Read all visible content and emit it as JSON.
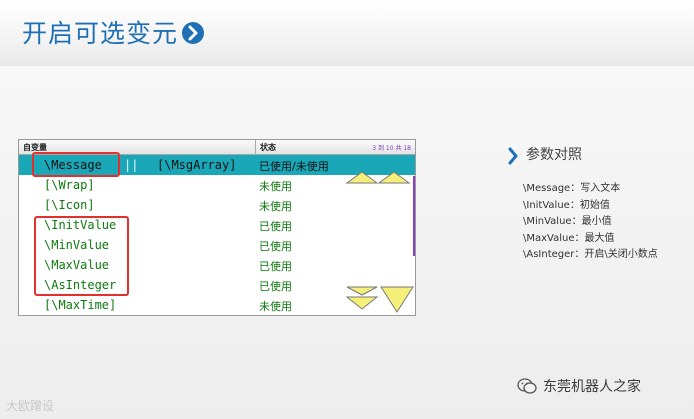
{
  "header": {
    "title": "开启可选变元"
  },
  "panel": {
    "col_arg": "自变量",
    "col_status": "状态",
    "pager": "3 到 10 共 18",
    "rows": [
      {
        "arg": "\\Message",
        "sep": "||",
        "alt": "[\\MsgArray]",
        "status": "已使用/未使用",
        "selected": true
      },
      {
        "arg": "[\\Wrap]",
        "status": "未使用"
      },
      {
        "arg": "[\\Icon]",
        "status": "未使用"
      },
      {
        "arg": "\\InitValue",
        "status": "已使用"
      },
      {
        "arg": "\\MinValue",
        "status": "已使用"
      },
      {
        "arg": "\\MaxValue",
        "status": "已使用"
      },
      {
        "arg": "\\AsInteger",
        "status": "已使用"
      },
      {
        "arg": "[\\MaxTime]",
        "status": "未使用"
      }
    ]
  },
  "reference": {
    "title": "参数对照",
    "items": [
      "\\Message：写入文本",
      "\\InitValue：初始值",
      "\\MinValue：最小值",
      "\\MaxValue：最大值",
      "\\AsInteger：开启\\关闭小数点"
    ]
  },
  "footer": {
    "left_watermark": "大欧蹭设",
    "right_account": "东莞机器人之家"
  },
  "colors": {
    "title_blue": "#1f6fb5",
    "selected_row": "#1aa8b8",
    "status_green": "#0d7a0d",
    "highlight_red": "#e4302c",
    "arrow_yellow": "#f4f07a"
  }
}
